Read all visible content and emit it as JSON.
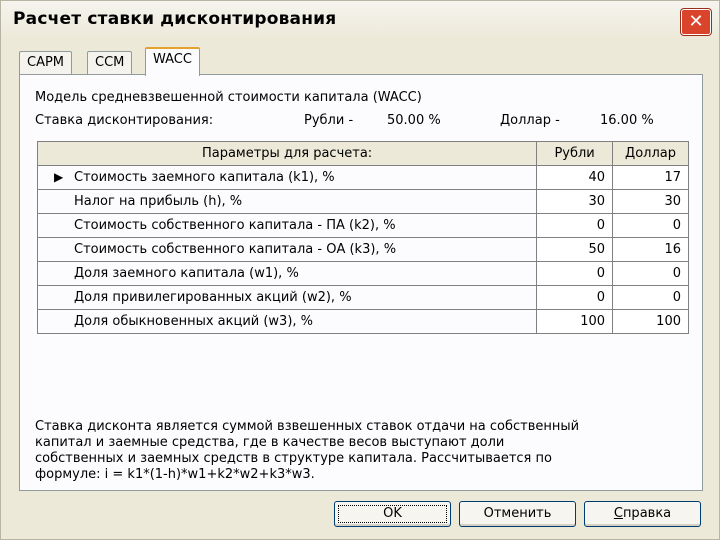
{
  "window": {
    "title": "Расчет ставки дисконтирования",
    "close_glyph": "✕"
  },
  "tabs": [
    {
      "label": "CAPM",
      "active": false
    },
    {
      "label": "CCM",
      "active": false
    },
    {
      "label": "WACC",
      "active": true
    }
  ],
  "model": {
    "title": "Модель средневзвешенной стоимости капитала (WACC)",
    "rate_label": "Ставка дисконтирования:",
    "rub_label": "Рубли -",
    "rub_value": "50.00 %",
    "usd_label": "Доллар -",
    "usd_value": "16.00 %"
  },
  "grid": {
    "headers": [
      "Параметры для расчета:",
      "Рубли",
      "Доллар"
    ],
    "current_row_indicator": "▶",
    "rows": [
      {
        "label": "Стоимость заемного капитала (k1), %",
        "rub": "40",
        "usd": "17"
      },
      {
        "label": "Налог на прибыль (h), %",
        "rub": "30",
        "usd": "30"
      },
      {
        "label": "Стоимость собственного капитала - ПА (k2), %",
        "rub": "0",
        "usd": "0"
      },
      {
        "label": "Стоимость собственного капитала - ОА (k3), %",
        "rub": "50",
        "usd": "16"
      },
      {
        "label": "Доля заемного капитала (w1), %",
        "rub": "0",
        "usd": "0"
      },
      {
        "label": "Доля привилегированных акций (w2), %",
        "rub": "0",
        "usd": "0"
      },
      {
        "label": "Доля обыкновенных акций (w3), %",
        "rub": "100",
        "usd": "100"
      }
    ]
  },
  "description": {
    "line1": "Ставка дисконта является суммой взвешенных ставок отдачи на собственный",
    "line2": "капитал и заемные средства, где в качестве весов выступают доли",
    "line3": "собственных и заемных средств в структуре капитала. Рассчитывается по",
    "line4": "формуле: i = k1*(1-h)*w1+k2*w2+k3*w3."
  },
  "buttons": {
    "ok": "OK",
    "cancel": "Отменить",
    "help_first": "С",
    "help_rest": "правка"
  }
}
